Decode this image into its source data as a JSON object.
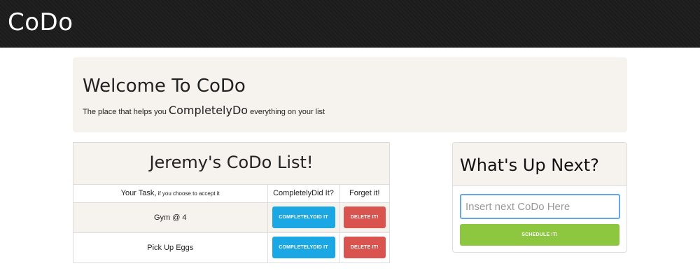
{
  "navbar": {
    "brand": "CoDo"
  },
  "jumbotron": {
    "title": "Welcome To CoDo",
    "subtitle_prefix": "The place that helps you ",
    "subtitle_emphasis": "CompletelyDo",
    "subtitle_suffix": " everything on your list"
  },
  "list": {
    "title": "Jeremy's CoDo List!",
    "headers": {
      "task": "Your Task,",
      "task_small": " if you choose to accept it",
      "done": "CompletelyDid It?",
      "forget": "Forget it!"
    },
    "rows": [
      {
        "task": "Gym @ 4",
        "done_label": "COMPLETELYDID IT",
        "delete_label": "DELETE IT!"
      },
      {
        "task": "Pick Up Eggs",
        "done_label": "COMPLETELYDID IT",
        "delete_label": "DELETE IT!"
      }
    ]
  },
  "next": {
    "title": "What's Up Next?",
    "input_value": "",
    "input_placeholder": "Insert next CoDo Here",
    "schedule_label": "SCHEDULE IT!"
  },
  "colors": {
    "navbar_bg": "#1c1c1c",
    "panel_bg": "#f6f3ee",
    "done_button": "#1ba7e3",
    "delete_button": "#d9534f",
    "schedule_button": "#8dc63f"
  }
}
